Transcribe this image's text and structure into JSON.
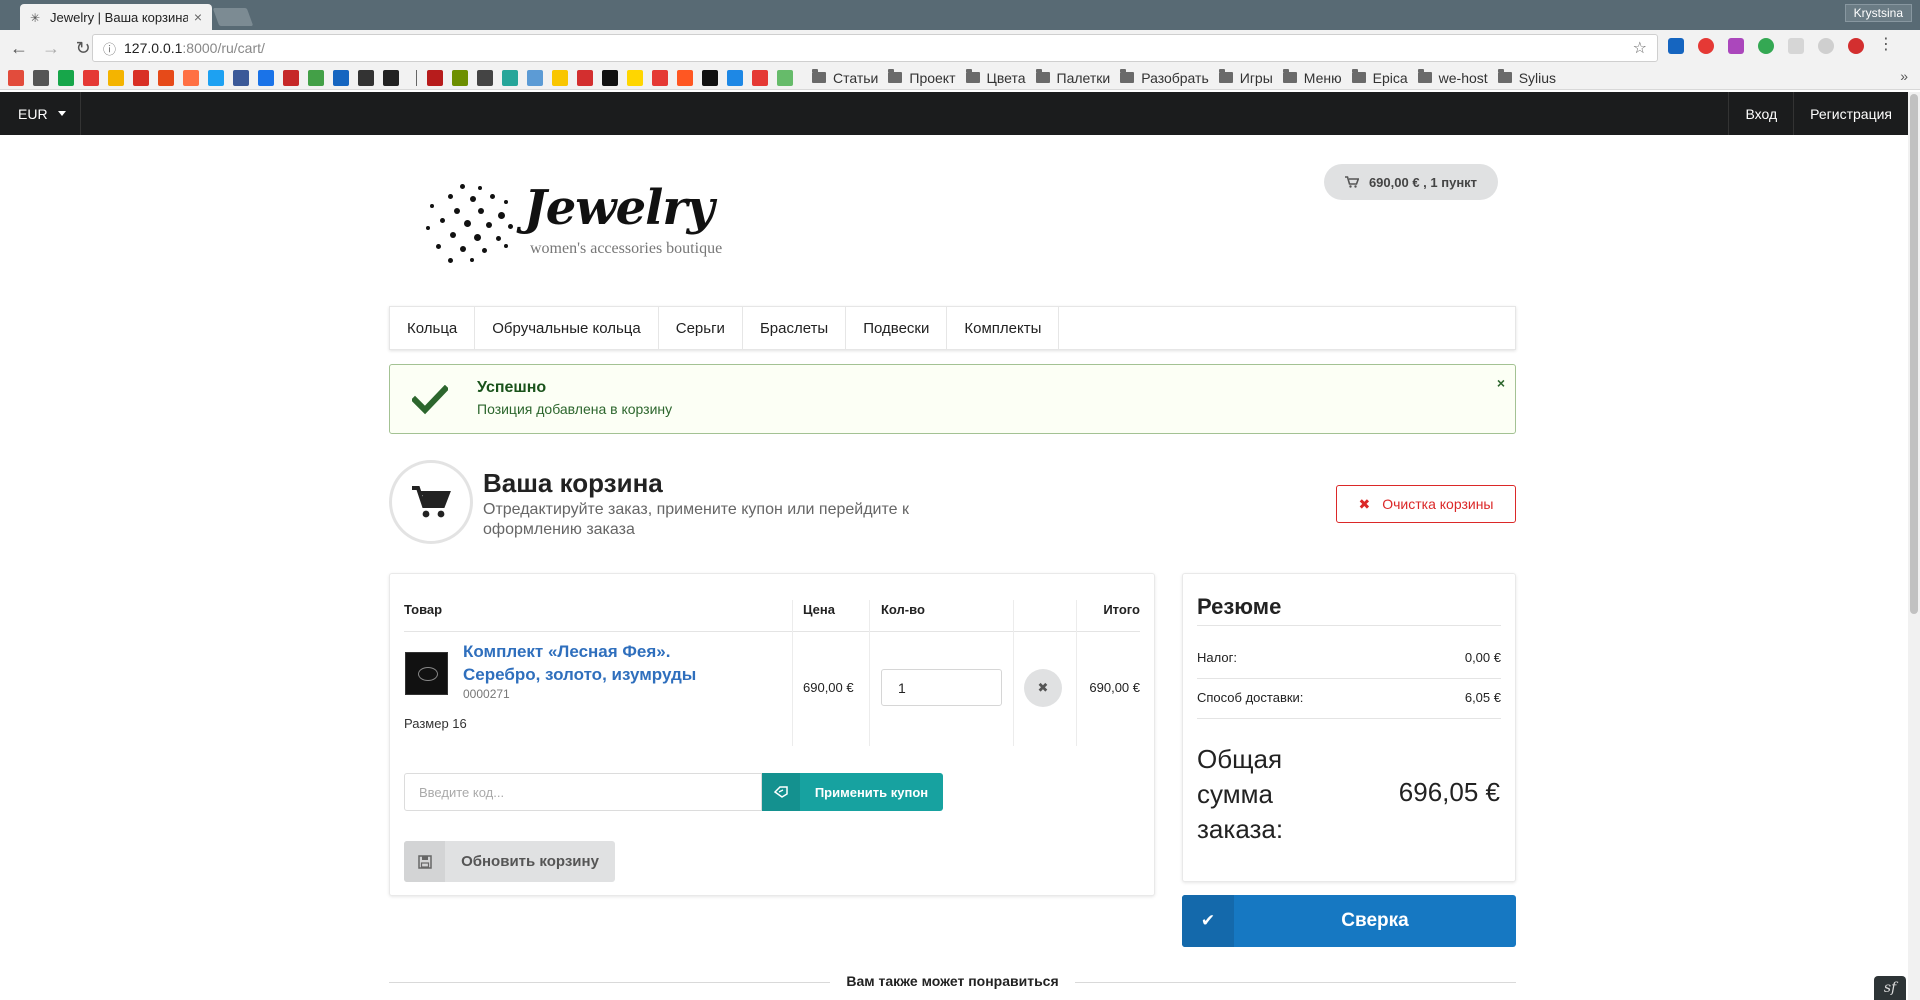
{
  "browser": {
    "tab_title": "Jewelry | Ваша корзина",
    "tab_close": "×",
    "profile_name": "Krystsina",
    "url_host": "127.0.0.1",
    "url_path": ":8000/ru/cart/",
    "bookmark_folders": [
      "Статьи",
      "Проект",
      "Цвета",
      "Палетки",
      "Разобрать",
      "Игры",
      "Меню",
      "Epica",
      "we-host",
      "Sylius"
    ],
    "bookmark_icon_colors": [
      "#e24c3c",
      "#555555",
      "#17a64a",
      "#e53935",
      "#f4b400",
      "#d93025",
      "#e64a19",
      "#ff7043",
      "#1da1f2",
      "#3b5998",
      "#1a73e8",
      "#c62828",
      "#43a047",
      "#1565c0",
      "#333333",
      "#222222",
      "#b71c1c",
      "#6d8f00",
      "#444444",
      "#26a69a",
      "#5c9bd5",
      "#f9c600",
      "#d32f2f",
      "#111111",
      "#ffd600",
      "#e53935",
      "#ff5722",
      "#111111",
      "#1e88e5",
      "#e53935",
      "#66bb6a"
    ]
  },
  "site": {
    "currency": "EUR",
    "login": "Вход",
    "register": "Регистрация",
    "logo_word": "Jewelry",
    "logo_tagline": "women's accessories boutique",
    "cart_summary": "690,00 € , 1 пункт"
  },
  "menu": [
    "Кольца",
    "Обручальные кольца",
    "Серьги",
    "Браслеты",
    "Подвески",
    "Комплекты"
  ],
  "alert": {
    "title": "Успешно",
    "message": "Позиция добавлена в корзину",
    "close": "×"
  },
  "page": {
    "title": "Ваша корзина",
    "subtitle": "Отредактируйте заказ, примените купон или перейдите к оформлению заказа",
    "clear_label": "Очистка корзины"
  },
  "cart": {
    "headers": {
      "product": "Товар",
      "price": "Цена",
      "qty": "Кол-во",
      "total": "Итого"
    },
    "item": {
      "name": "Комплект «Лесная Фея». Серебро, золото, изумруды",
      "code": "0000271",
      "option": "Размер 16",
      "price": "690,00 €",
      "quantity": "1",
      "total": "690,00 €"
    },
    "coupon_placeholder": "Введите код...",
    "coupon_button": "Применить купон",
    "update_button": "Обновить корзину"
  },
  "summary": {
    "title": "Резюме",
    "tax_label": "Налог:",
    "tax_value": "0,00 €",
    "shipping_label": "Способ доставки:",
    "shipping_value": "6,05 €",
    "total_label": "Общая сумма заказа:",
    "total_value": "696,05 €"
  },
  "checkout_button": "Сверка",
  "also_like": "Вам также может понравиться",
  "colors": {
    "accent_blue": "#1678c2",
    "coupon_teal": "#17a2a0",
    "danger_red": "#db2828",
    "success_green": "#21ba45"
  }
}
